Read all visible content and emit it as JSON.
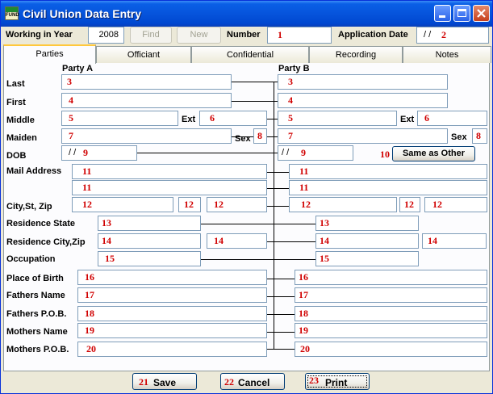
{
  "window": {
    "title": "Civil Union Data Entry",
    "icon_text": "FUND"
  },
  "header": {
    "year_label": "Working in Year",
    "year_value": "2008",
    "find_label": "Find",
    "new_label": "New",
    "number_label": "Number",
    "number_marker": "1",
    "appdate_label": "Application Date",
    "appdate_value": "/ /",
    "appdate_marker": "2"
  },
  "tabs": [
    "Parties",
    "Officiant",
    "Confidential",
    "Recording",
    "Notes"
  ],
  "columns": {
    "a": "Party A",
    "b": "Party B"
  },
  "labels": {
    "last": "Last",
    "first": "First",
    "middle": "Middle",
    "maiden": "Maiden",
    "dob": "DOB",
    "mail": "Mail Address",
    "csz": "City,St, Zip",
    "res_state": "Residence State",
    "res_city": "Residence City,Zip",
    "occupation": "Occupation",
    "pob": "Place of Birth",
    "fathers_name": "Fathers Name",
    "fathers_pob": "Fathers P.O.B.",
    "mothers_name": "Mothers Name",
    "mothers_pob": "Mothers P.O.B.",
    "ext_a": "Ext",
    "ext_b": "Ext",
    "sex_a": "Sex",
    "sex_b": "Sex"
  },
  "markers": {
    "last": "3",
    "first": "4",
    "middle": "5",
    "ext": "6",
    "maiden": "7",
    "sex": "8",
    "dob": "9",
    "mail": "11",
    "csz": "12",
    "res_state": "13",
    "res_city": "14",
    "occupation": "15",
    "pob": "16",
    "fathers_name": "17",
    "fathers_pob": "18",
    "mothers_name": "19",
    "mothers_pob": "20",
    "same": "10",
    "save": "21",
    "cancel": "22",
    "print": "23"
  },
  "dob_prefix": "/ /",
  "buttons": {
    "same_as_other": "Same as Other",
    "save": "Save",
    "cancel": "Cancel",
    "print": "Print"
  }
}
